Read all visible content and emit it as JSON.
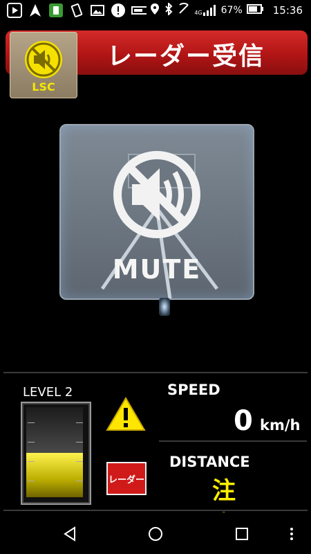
{
  "status_bar": {
    "left_icons": [
      "play-store-icon",
      "navigation-icon",
      "app-icon",
      "vibrate-icon",
      "gallery-icon",
      "alert-icon",
      "storage-icon"
    ],
    "right_icons": [
      "location-icon",
      "bluetooth-icon",
      "nfc-icon",
      "signal-4g-icon"
    ],
    "network_label": "4G",
    "battery_text": "67%",
    "time": "15:36"
  },
  "header": {
    "title": "レーダー受信",
    "lsc_label": "LSC",
    "accent_color": "#c21f1f"
  },
  "mute_panel": {
    "label": "MUTE"
  },
  "dashboard": {
    "level_label": "LEVEL 2",
    "level_fill_fraction": 0.45,
    "warning_icon": "warning-triangle-icon",
    "radar_badge_text": "レーダー",
    "speed_label": "SPEED",
    "speed_value": "0",
    "speed_unit": "km/h",
    "distance_label": "DISTANCE",
    "distance_value": "注 意",
    "highlight_color": "#ffee00"
  },
  "nav_bar": {
    "buttons": [
      "back-icon",
      "home-icon",
      "recents-icon",
      "more-icon"
    ]
  }
}
